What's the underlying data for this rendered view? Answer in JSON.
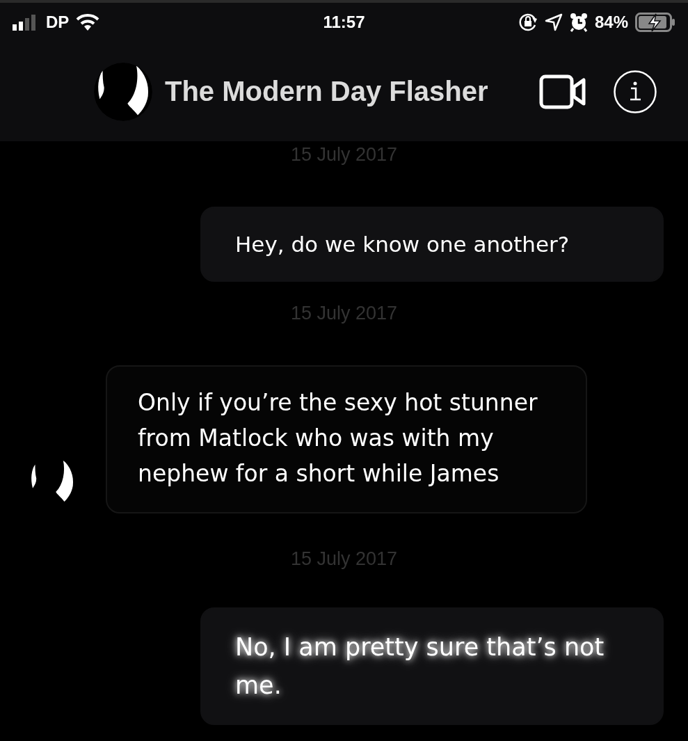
{
  "status_bar": {
    "carrier": "DP",
    "time": "11:57",
    "battery_percent": "84%",
    "charging": true
  },
  "header": {
    "title": "The Modern Day Flasher"
  },
  "messages": [
    {
      "kind": "date",
      "text": "15 July 2017"
    },
    {
      "kind": "outgoing",
      "text": "Hey, do we know one another?",
      "glow": false
    },
    {
      "kind": "date",
      "text": "15 July 2017"
    },
    {
      "kind": "incoming",
      "text": "Only if you’re the sexy hot stunner from Matlock who was with my nephew for a short while James",
      "glow": false
    },
    {
      "kind": "date",
      "text": "15 July 2017"
    },
    {
      "kind": "outgoing",
      "text": "No, I am pretty sure that’s not me.",
      "glow": true
    }
  ]
}
